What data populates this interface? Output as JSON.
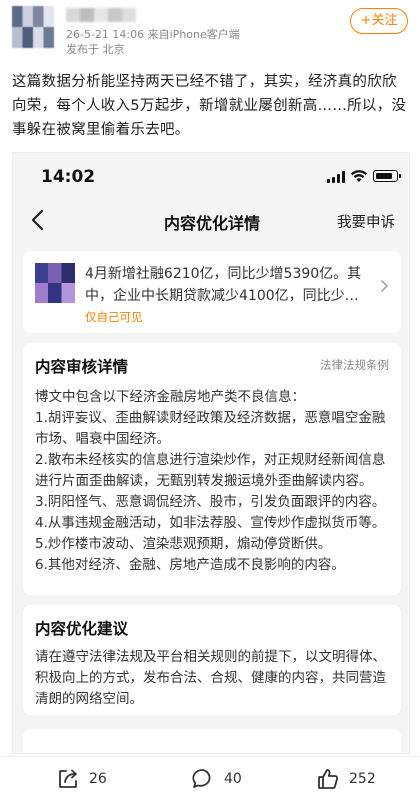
{
  "post": {
    "meta_line1": "26-5-21 14:06  来自iPhone客户端",
    "meta_line2": "发布于 北京",
    "follow_label": "+关注",
    "text": "这篇数据分析能坚持两天已经不错了，其实，经济真的欣欣向荣，每个人收入5万起步，新增就业屡创新高……所以，没事躲在被窝里偷着乐去吧。"
  },
  "screenshot": {
    "status_time": "14:02",
    "nav_title": "内容优化详情",
    "nav_action": "我要申诉",
    "notice": {
      "text": "4月新增社融6210亿，同比少增5390亿。其中，企业中长期贷款减少4100亿，同比少…",
      "visibility": "仅自己可见"
    },
    "review": {
      "title": "内容审核详情",
      "link": "法律法规条例",
      "lines": [
        "博文中包含以下经济金融房地产类不良信息：",
        "1.胡评妄议、歪曲解读财经政策及经济数据，恶意唱空金融市场、唱衰中国经济。",
        "2.散布未经核实的信息进行渲染炒作，对正规财经新闻信息进行片面歪曲解读，无甄别转发搬运境外歪曲解读内容。",
        "3.阴阳怪气、恶意调侃经济、股市，引发负面跟评的内容。",
        "4.从事违规金融活动，如非法荐股、宣传炒作虚拟货币等。",
        "5.炒作楼市波动、渲染悲观预期，煽动停贷断供。",
        "6.其他对经济、金融、房地产造成不良影响的内容。"
      ]
    },
    "advice": {
      "title": "内容优化建议",
      "text": "请在遵守法律法规及平台相关规则的前提下，以文明得体、积极向上的方式，发布合法、合规、健康的内容，共同营造清朗的网络空间。"
    }
  },
  "toolbar": {
    "share_count": "26",
    "comment_count": "40",
    "like_count": "252"
  },
  "colors": {
    "accent": "#ff8200",
    "background": "#ffffff",
    "screenshot_bg": "#f5f5f5"
  },
  "icons": [
    "share-icon",
    "comment-icon",
    "like-icon",
    "back-icon",
    "chevron-right-icon",
    "signal-icon",
    "wifi-icon",
    "battery-icon"
  ]
}
